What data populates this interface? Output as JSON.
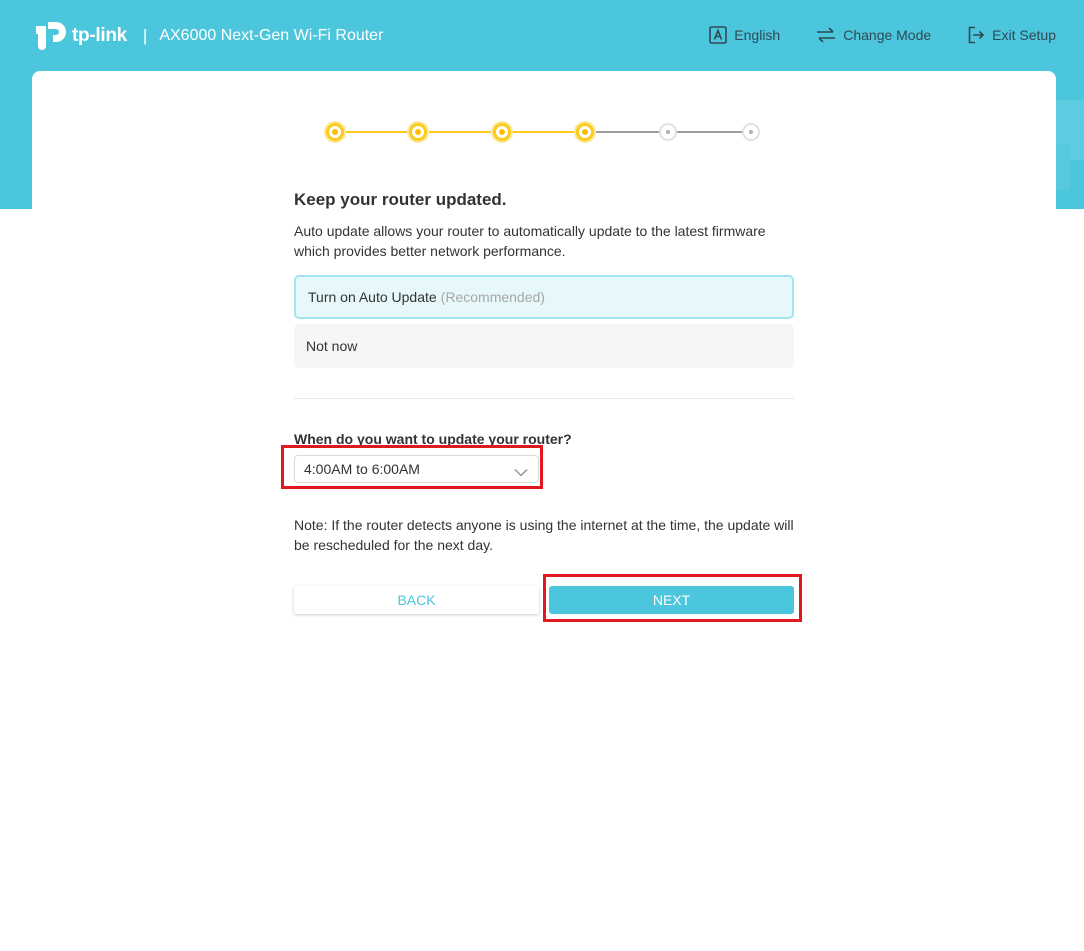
{
  "header": {
    "brand": "tp-link",
    "separator": "|",
    "product": "AX6000 Next-Gen Wi-Fi Router",
    "nav": {
      "language": "English",
      "change_mode": "Change Mode",
      "exit_setup": "Exit Setup"
    }
  },
  "stepper": {
    "total_steps": 6,
    "completed_steps": 4,
    "active_color": "#fccb1c",
    "inactive_color": "#9e9e9e"
  },
  "main": {
    "title": "Keep your router updated.",
    "description": "Auto update allows your router to automatically update to the latest firmware which provides better network performance.",
    "options": [
      {
        "label": "Turn on Auto Update",
        "hint": "(Recommended)",
        "selected": true
      },
      {
        "label": "Not now",
        "selected": false
      }
    ],
    "schedule": {
      "question": "When do you want to update your router?",
      "selected_value": "4:00AM to 6:00AM"
    },
    "note": "Note: If the router detects anyone is using the internet at the time, the update will be rescheduled for the next day.",
    "buttons": {
      "back": "BACK",
      "next": "NEXT"
    }
  },
  "colors": {
    "brand": "#4cc6dc",
    "highlight": "#e0181f"
  }
}
